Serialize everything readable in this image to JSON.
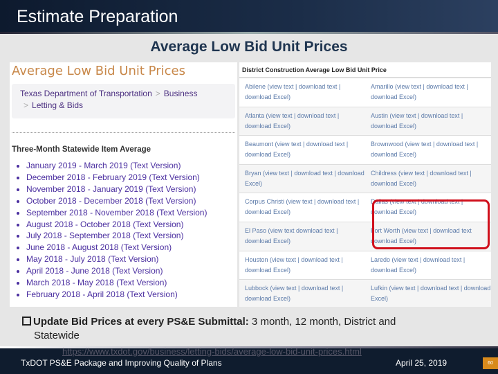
{
  "header": {
    "title": "Estimate Preparation"
  },
  "subtitle": "Average Low Bid Unit Prices",
  "left_panel": {
    "title": "Average Low Bid Unit Prices",
    "breadcrumb": [
      "Texas Department of Transportation",
      "Business",
      "Letting & Bids"
    ],
    "section_title": "Three-Month Statewide Item Average",
    "items": [
      "January 2019 - March 2019 (Text Version)",
      "December 2018 - February 2019 (Text Version)",
      "November 2018 - January 2019 (Text Version)",
      "October 2018 - December 2018 (Text Version)",
      "September 2018 - November 2018 (Text Version)",
      "August 2018 - October 2018 (Text Version)",
      "July 2018 - September 2018 (Text Version)",
      "June 2018 - August 2018 (Text Version)",
      "May 2018 - July 2018 (Text Version)",
      "April 2018 - June 2018 (Text Version)",
      "March 2018 - May 2018 (Text Version)",
      "February 2018 - April 2018 (Text Version)"
    ]
  },
  "right_panel": {
    "title": "District Construction Average Low Bid Unit Price",
    "districts": [
      {
        "name": "Abilene",
        "links": "(view text | download text | download Excel)"
      },
      {
        "name": "Amarillo",
        "links": "(view text | download text | download Excel)"
      },
      {
        "name": "Atlanta",
        "links": "(view text | download text | download Excel)"
      },
      {
        "name": "Austin",
        "links": "(view text | download text | download Excel)"
      },
      {
        "name": "Beaumont",
        "links": "(view text | download text | download Excel)"
      },
      {
        "name": "Brownwood",
        "links": "(view text | download text | download Excel)"
      },
      {
        "name": "Bryan",
        "links": "(view text | download text | download Excel)"
      },
      {
        "name": "Childress",
        "links": "(view text | download text | download Excel)"
      },
      {
        "name": "Corpus Christi",
        "links": "(view text | download text | download Excel)"
      },
      {
        "name": "Dallas",
        "links": "(view text | download text | download Excel)"
      },
      {
        "name": "El Paso",
        "links": "(view text download text | download Excel)"
      },
      {
        "name": "Fort Worth",
        "links": "(view text | download text download Excel)"
      },
      {
        "name": "Houston",
        "links": "(view text | download text | download Excel)"
      },
      {
        "name": "Laredo",
        "links": "(view text | download text | download Excel)"
      },
      {
        "name": "Lubbock",
        "links": "(view text | download text | download Excel)"
      },
      {
        "name": "Lufkin",
        "links": "(view text | download text | download Excel)"
      }
    ],
    "highlight_color": "#d0101c"
  },
  "bullet": {
    "bold": "Update Bid Prices at every PS&E Submittal:",
    "text": " 3 month, 12 month, District and",
    "cont": "Statewide"
  },
  "footer": {
    "url": "https://www.txdot.gov/business/letting-bids/average-low-bid-unit-prices.html",
    "left": "TxDOT PS&E Package and Improving Quality of Plans",
    "date": "April 25, 2019",
    "page": "60"
  }
}
